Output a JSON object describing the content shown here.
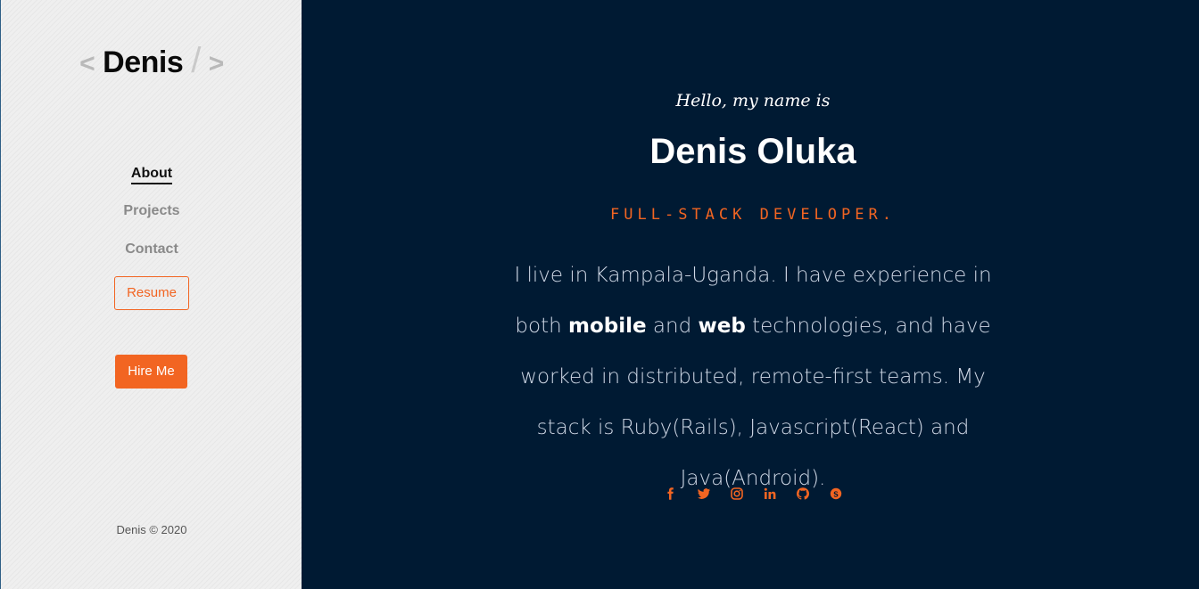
{
  "sidebar": {
    "logo": {
      "left_bracket": "<",
      "name": "Denis",
      "slash": "/",
      "right_bracket": ">"
    },
    "nav": {
      "about": "About",
      "projects": "Projects",
      "contact": "Contact"
    },
    "resume_label": "Resume",
    "hire_label": "Hire Me",
    "copyright": "Denis © 2020"
  },
  "hero": {
    "greeting": "Hello, my name is",
    "name": "Denis Oluka",
    "role": "FULL-STACK DEVELOPER.",
    "bio": {
      "part1": "I live in Kampala-Uganda. I have experience in both ",
      "mobile": "mobile",
      "part2": " and ",
      "web": "web",
      "part3": " technologies, and have worked in distributed, remote-first teams. My stack is Ruby(Rails), Javascript(React) and Java(Android)."
    }
  },
  "social_icons": [
    "facebook-icon",
    "twitter-icon",
    "instagram-icon",
    "linkedin-icon",
    "github-icon",
    "skype-icon"
  ],
  "colors": {
    "accent": "#f26522",
    "main_bg": "#001a33",
    "sidebar_bg": "#efefef"
  }
}
